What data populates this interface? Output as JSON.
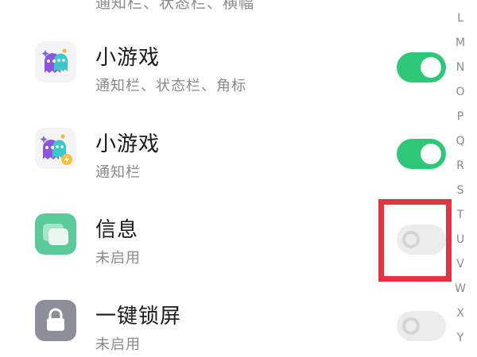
{
  "top_partial_subtitle": "通知栏、状态栏、横幅",
  "apps": [
    {
      "title": "小游戏",
      "subtitle": "通知栏、状态栏、角标",
      "icon": "ghost-game-icon",
      "enabled": true
    },
    {
      "title": "小游戏",
      "subtitle": "通知栏",
      "icon": "ghost-game-badge-icon",
      "enabled": true
    },
    {
      "title": "信息",
      "subtitle": "未启用",
      "icon": "messages-icon",
      "enabled": false
    },
    {
      "title": "一键锁屏",
      "subtitle": "未启用",
      "icon": "lock-screen-icon",
      "enabled": false
    }
  ],
  "alphabet_index": [
    "L",
    "M",
    "N",
    "O",
    "P",
    "Q",
    "R",
    "S",
    "T",
    "U",
    "V",
    "W",
    "X",
    "Y"
  ],
  "colors": {
    "toggle_on": "#2ec778",
    "toggle_off": "#ececec",
    "highlight": "#e03545",
    "messages_icon": "#5bc99a",
    "lock_icon": "#8e8e98"
  }
}
